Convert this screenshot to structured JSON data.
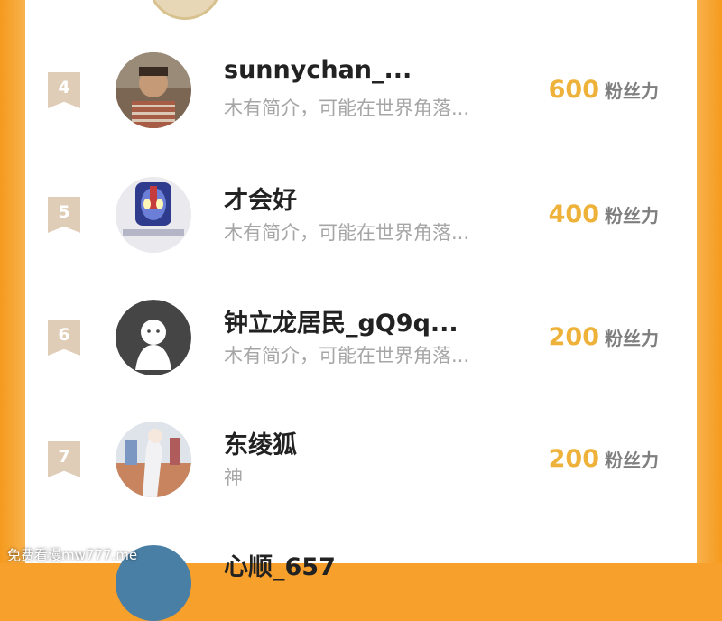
{
  "rows": [
    {
      "rank": "4",
      "name": "sunnychan_...",
      "bio": "木有简介，可能在世界角落...",
      "fans": "600",
      "fans_label": "粉丝力",
      "avatar_icon": "boy-photo-avatar"
    },
    {
      "rank": "5",
      "name": "才会好",
      "bio": "木有简介，可能在世界角落...",
      "fans": "400",
      "fans_label": "粉丝力",
      "avatar_icon": "ultraman-avatar"
    },
    {
      "rank": "6",
      "name": "钟立龙居民_gQ9q...",
      "bio": "木有简介，可能在世界角落...",
      "fans": "200",
      "fans_label": "粉丝力",
      "avatar_icon": "default-user-avatar"
    },
    {
      "rank": "7",
      "name": "东绫狐",
      "bio": "神",
      "fans": "200",
      "fans_label": "粉丝力",
      "avatar_icon": "anime-art-avatar"
    }
  ],
  "partial_next": {
    "name": "心顺_657"
  },
  "watermark": "免费看漫mw777.me",
  "colors": {
    "frame": "#f7a02c",
    "fans_number": "#eeb23a",
    "rank_badge": "#e0cdb7"
  }
}
